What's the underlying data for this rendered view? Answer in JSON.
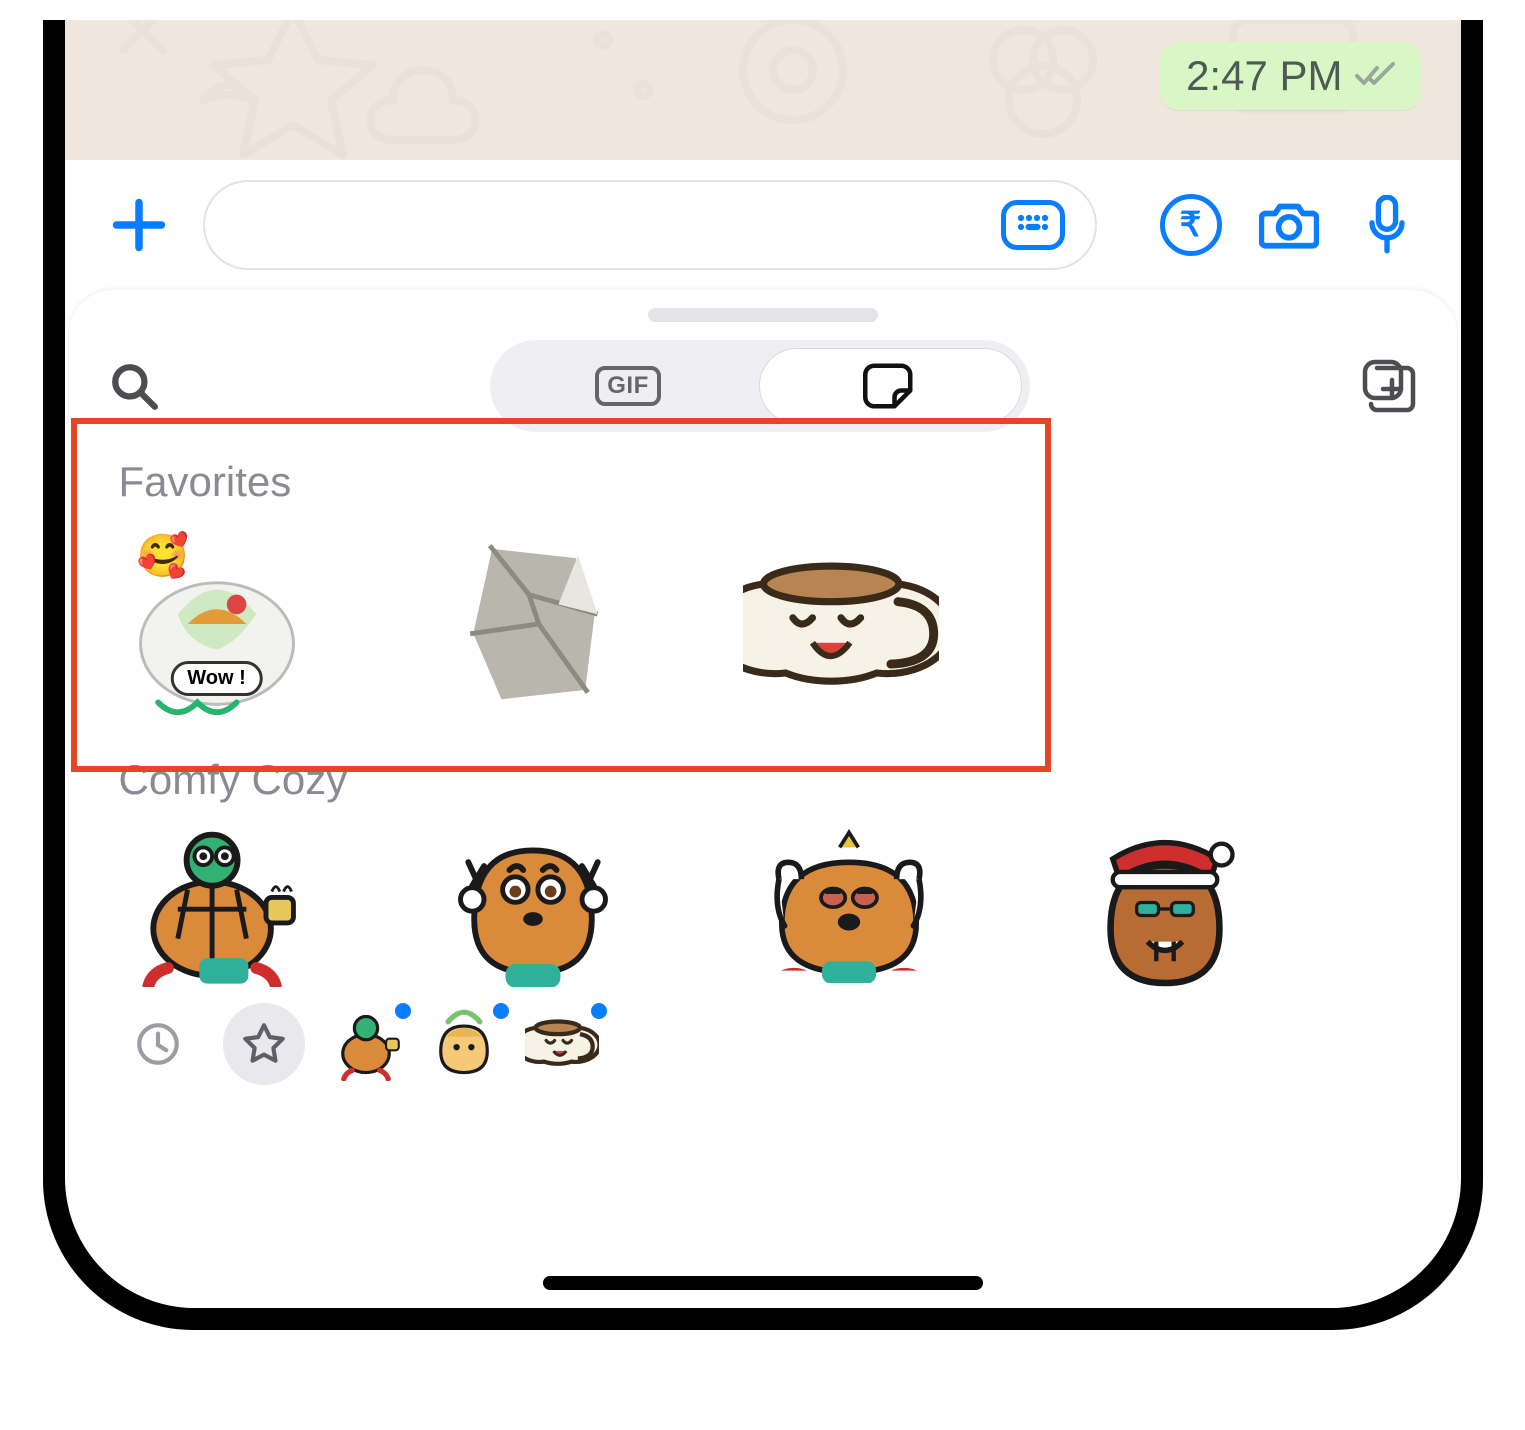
{
  "chat": {
    "last_time": "2:47 PM",
    "read_status": "delivered"
  },
  "tabs": {
    "gif_label": "GIF"
  },
  "sections": {
    "favorites": {
      "title": "Favorites",
      "stickers": [
        {
          "name": "food-wow-sticker",
          "caption": "Wow !"
        },
        {
          "name": "foil-wrap-sticker"
        },
        {
          "name": "coffee-cup-smile-sticker"
        }
      ]
    },
    "comfy": {
      "title": "Comfy Cozy",
      "stickers": [
        {
          "name": "turtle-tea-sticker"
        },
        {
          "name": "potato-peace-sticker"
        },
        {
          "name": "potato-sleepy-sticker"
        },
        {
          "name": "potato-santa-sticker"
        }
      ]
    }
  },
  "icons": {
    "plus": "plus-icon",
    "keyboard": "sticker-keyboard-icon",
    "rupee": "₹",
    "camera": "camera-icon",
    "mic": "mic-icon",
    "search": "search-icon",
    "add_pack": "add-sticker-pack-icon",
    "recent": "recent-icon",
    "star": "favorites-icon"
  },
  "packs": [
    {
      "name": "comfy-cozy-pack",
      "new": true
    },
    {
      "name": "rain-fairy-pack",
      "new": true
    },
    {
      "name": "coffee-pack",
      "new": true
    }
  ]
}
